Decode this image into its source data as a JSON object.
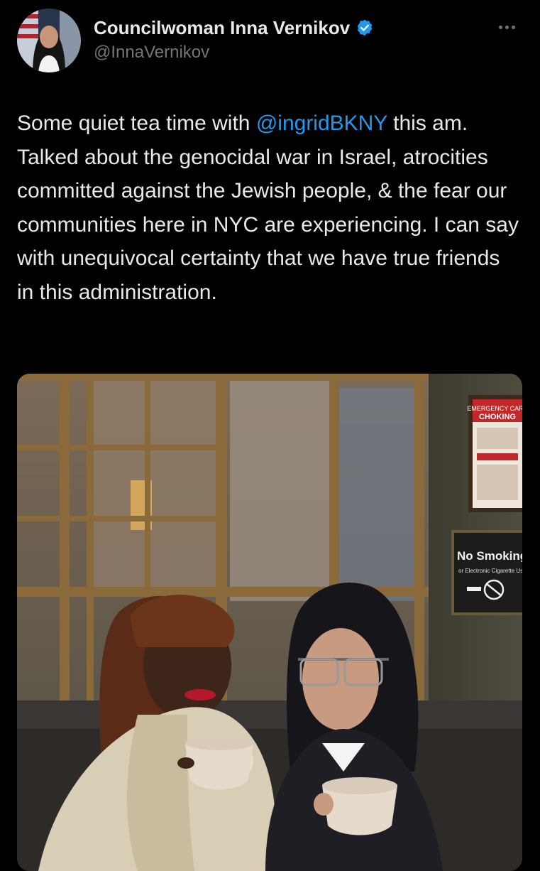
{
  "author": {
    "display_name": "Councilwoman Inna Vernikov",
    "handle": "@InnaVernikov",
    "verified": true,
    "verified_color": "#1d9bf0"
  },
  "menu": {
    "icon": "more-horizontal-icon"
  },
  "tweet": {
    "text_before": "Some quiet tea time with ",
    "mention": "@ingridBKNY",
    "text_after": " this am. Talked about the genocidal war in Israel, atrocities committed against the Jewish people, & the fear our communities here in NYC are experiencing. I can say with unequivocal certainty that we have true friends in this administration."
  },
  "media": {
    "signs": {
      "emergency_line1": "EMERGENCY CARE",
      "emergency_line2": "CHOKING",
      "no_smoking_line1": "No Smoking",
      "no_smoking_line2": "or Electronic Cigarette Use"
    }
  },
  "colors": {
    "background": "#000000",
    "text": "#e7e9ea",
    "secondary": "#71767b",
    "link": "#1d9bf0"
  }
}
